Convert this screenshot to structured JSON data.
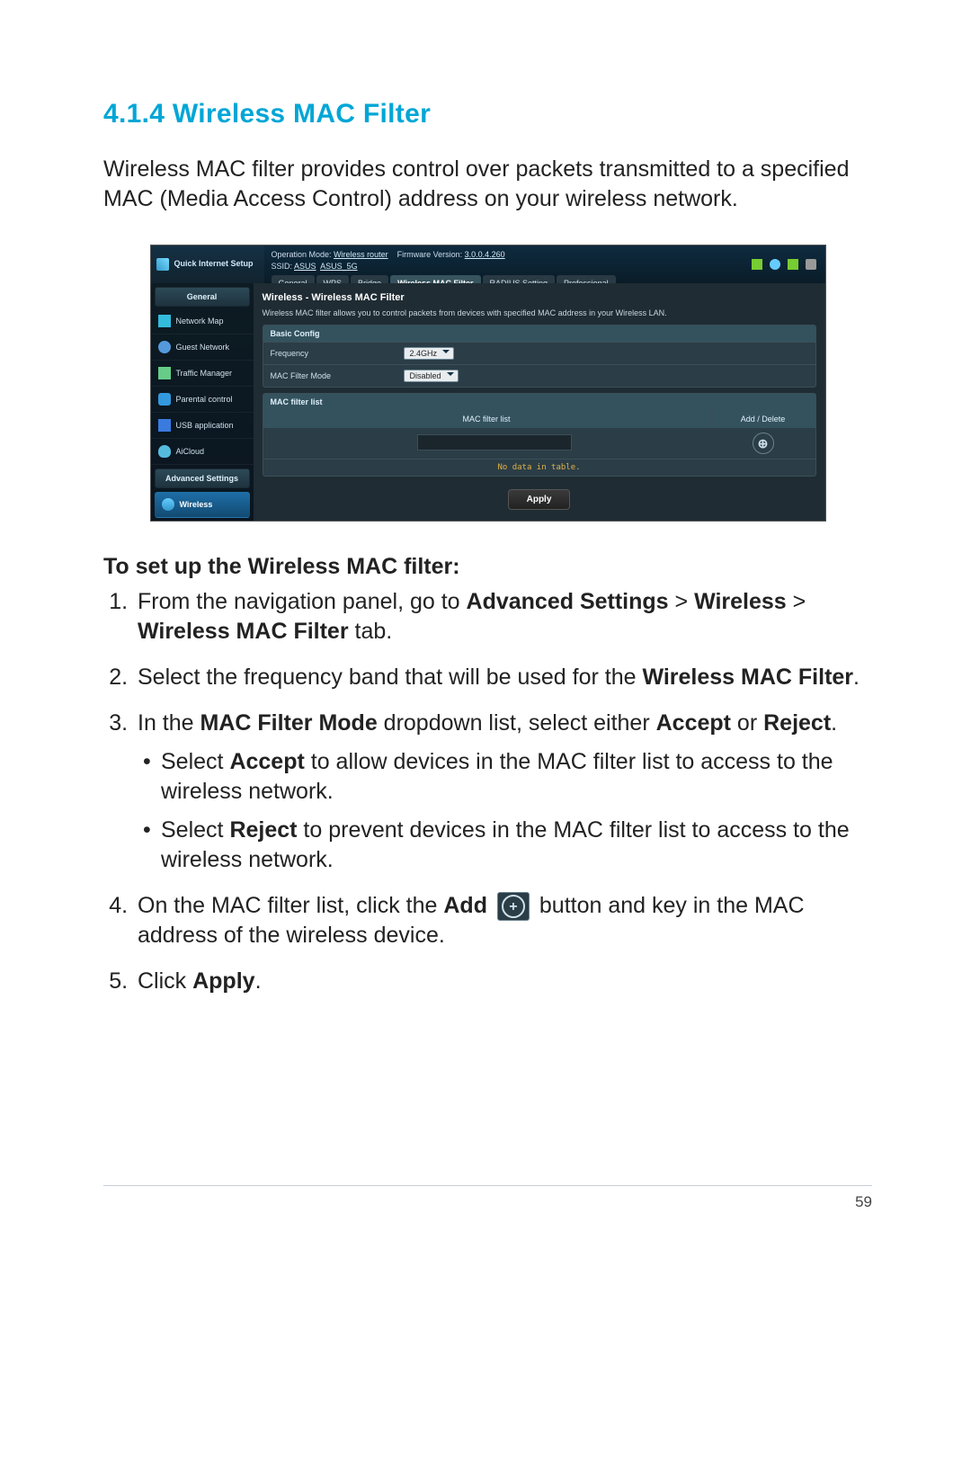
{
  "section": {
    "number": "4.1.4",
    "title": "Wireless MAC Filter",
    "intro": "Wireless MAC filter provides control over packets transmitted to a specified MAC (Media Access Control) address on your wireless network."
  },
  "screenshot": {
    "qis": "Quick Internet Setup",
    "status": {
      "op_mode_label": "Operation Mode:",
      "op_mode_value": "Wireless router",
      "fw_label": "Firmware Version:",
      "fw_value": "3.0.0.4.260",
      "ssid_label": "SSID:",
      "ssid1": "ASUS",
      "ssid2": "ASUS_5G"
    },
    "tabs": [
      "General",
      "WPS",
      "Bridge",
      "Wireless MAC Filter",
      "RADIUS Setting",
      "Professional"
    ],
    "active_tab": "Wireless MAC Filter",
    "side": {
      "cat_general": "General",
      "items_general": [
        "Network Map",
        "Guest Network",
        "Traffic Manager",
        "Parental control",
        "USB application",
        "AiCloud"
      ],
      "cat_advanced": "Advanced Settings",
      "items_advanced": [
        "Wireless"
      ]
    },
    "panel": {
      "title": "Wireless - Wireless MAC Filter",
      "desc": "Wireless MAC filter allows you to control packets from devices with specified MAC address in your Wireless LAN.",
      "basic_config": "Basic Config",
      "frequency_label": "Frequency",
      "frequency_value": "2.4GHz",
      "mode_label": "MAC Filter Mode",
      "mode_value": "Disabled",
      "maclist_header": "MAC filter list",
      "col1": "MAC filter list",
      "col2": "Add / Delete",
      "nodata": "No data in table.",
      "apply": "Apply"
    }
  },
  "instructions": {
    "heading": "To set up the Wireless MAC filter:",
    "step1_a": "From the navigation panel, go to ",
    "step1_b": "Advanced Settings",
    "step1_c": " > ",
    "step1_d": "Wireless",
    "step1_e": " > ",
    "step1_f": "Wireless MAC Filter",
    "step1_g": " tab.",
    "step2_a": "Select the frequency band that will be used for the ",
    "step2_b": "Wireless MAC Filter",
    "step2_c": ".",
    "step3_a": "In the ",
    "step3_b": "MAC Filter Mode",
    "step3_c": " dropdown list, select either ",
    "step3_d": "Accept",
    "step3_e": " or ",
    "step3_f": "Reject",
    "step3_g": ".",
    "step3_sub1_a": "Select ",
    "step3_sub1_b": "Accept",
    "step3_sub1_c": " to allow devices in the MAC filter list to access to the wireless network.",
    "step3_sub2_a": "Select ",
    "step3_sub2_b": "Reject",
    "step3_sub2_c": " to prevent devices in the MAC filter list to access to the wireless network.",
    "step4_a": "On the MAC filter list, click the ",
    "step4_b": "Add",
    "step4_c": " button and key in the MAC address of the wireless device.",
    "step5_a": "Click ",
    "step5_b": "Apply",
    "step5_c": "."
  },
  "page_number": "59"
}
